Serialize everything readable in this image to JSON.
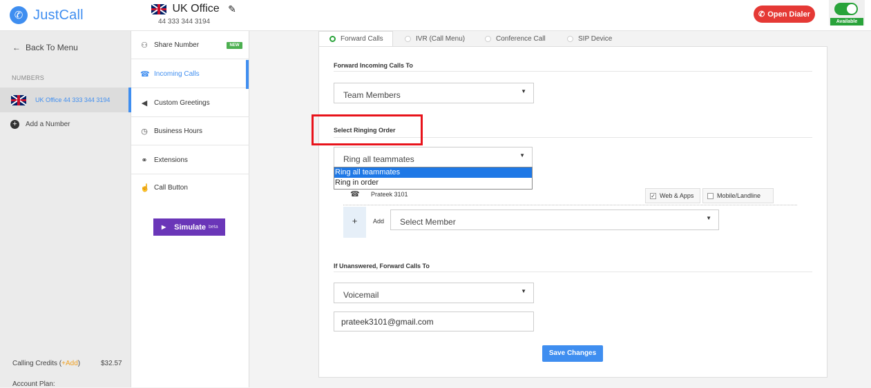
{
  "header": {
    "logo_text": "JustCall",
    "number_name": "UK Office",
    "number_value": "44 333 344 3194",
    "open_dialer": "Open Dialer",
    "availability": "Available"
  },
  "sidebar": {
    "back": "Back To Menu",
    "section_label": "NUMBERS",
    "number_item": "UK Office   44 333 344 3194",
    "add_number": "Add a Number",
    "credits_label": "Calling Credits (",
    "credits_add": "+Add",
    "credits_close": ")",
    "credits_value": "$32.57",
    "account_plan": "Account Plan:"
  },
  "menu": {
    "items": [
      {
        "label": "Share Number",
        "icon": "share-icon",
        "glyph": "⚇"
      },
      {
        "label": "Incoming Calls",
        "icon": "phone-icon",
        "glyph": "☎"
      },
      {
        "label": "Custom Greetings",
        "icon": "speaker-icon",
        "glyph": "◀"
      },
      {
        "label": "Business Hours",
        "icon": "clock-icon",
        "glyph": "◷"
      },
      {
        "label": "Extensions",
        "icon": "link-icon",
        "glyph": "⚭"
      },
      {
        "label": "Call Button",
        "icon": "pointer-icon",
        "glyph": "☝"
      }
    ],
    "new_badge": "NEW",
    "simulate": "Simulate",
    "simulate_beta": "beta"
  },
  "tabs": [
    "Forward Calls",
    "IVR (Call Menu)",
    "Conference Call",
    "SIP Device"
  ],
  "form": {
    "forward_title": "Forward Incoming Calls To",
    "forward_value": "Team Members",
    "ringing_title": "Select Ringing Order",
    "ringing_value": "Ring all teammates",
    "ringing_options": [
      "Ring all teammates",
      "Ring in order"
    ],
    "member_name": "Prateek 3101",
    "web_apps": "Web & Apps",
    "mobile_landline": "Mobile/Landline",
    "add_label": "Add",
    "select_member": "Select Member",
    "unanswered_title": "If Unanswered, Forward Calls To",
    "unanswered_value": "Voicemail",
    "email_value": "prateek3101@gmail.com",
    "save": "Save Changes"
  },
  "colors": {
    "brand": "#3f8ef0",
    "dialer": "#e53935",
    "available": "#29a33a",
    "simulate": "#6a36b8",
    "highlight": "#e8131b"
  }
}
